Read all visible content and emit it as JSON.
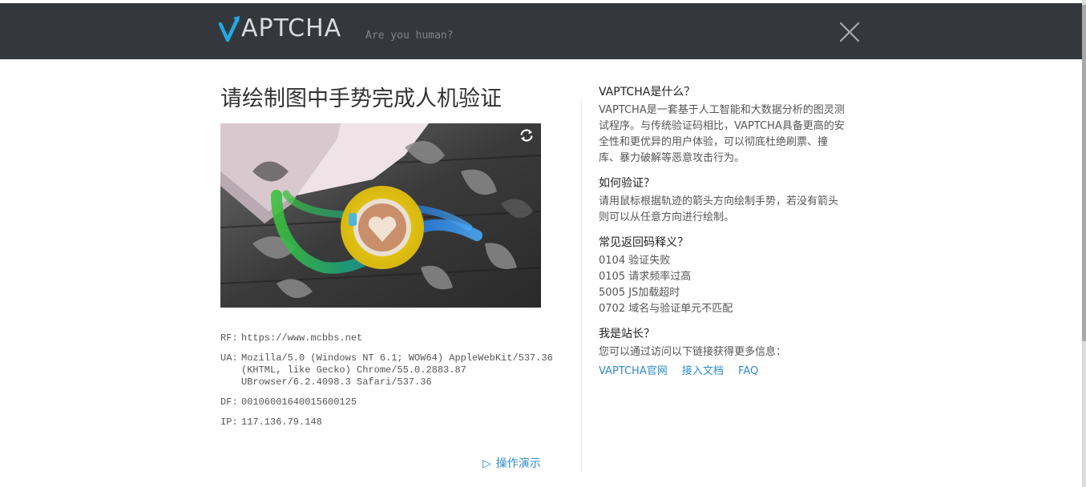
{
  "header": {
    "logo_text": "APTCHA",
    "tagline": "Are you human?",
    "colors": {
      "bar": "#34383c",
      "logo_accent": "#21a9e6",
      "logo_text": "#d7dadd"
    }
  },
  "left": {
    "title": "请绘制图中手势完成人机验证",
    "info": {
      "rf_label": "RF:",
      "rf_value": "https://www.mcbbs.net",
      "ua_label": "UA:",
      "ua_line1": "Mozilla/5.0 (Windows NT 6.1; WOW64) AppleWebKit/537.36",
      "ua_line2": "(KHTML, like Gecko) Chrome/55.0.2883.87",
      "ua_line3": "UBrowser/6.2.4098.3 Safari/537.36",
      "df_label": "DF:",
      "df_value": "00106001640015600125",
      "ip_label": "IP:",
      "ip_value": "117.136.79.148"
    },
    "demo_label": "操作演示"
  },
  "right": {
    "s1_title": "VAPTCHA是什么？",
    "s1_lines": [
      "VAPTCHA是一套基于人工智能和大数据分析的图灵测",
      "试程序。与传统验证码相比，VAPTCHA具备更高的安",
      "全性和更优异的用户体验，可以彻底杜绝刷票、撞",
      "库、暴力破解等恶意攻击行为。"
    ],
    "s2_title": "如何验证？",
    "s2_lines": [
      "请用鼠标根据轨迹的箭头方向绘制手势，若没有箭头",
      "则可以从任意方向进行绘制。"
    ],
    "s3_title": "常见返回码释义？",
    "codes": [
      "0104 验证失败",
      "0105 请求频率过高",
      "5005 JS加载超时",
      "0702 域名与验证单元不匹配"
    ],
    "s4_title": "我是站长？",
    "s4_text": "您可以通过访问以下链接获得更多信息：",
    "links": [
      "VAPTCHA官网",
      "接入文档",
      "FAQ"
    ]
  },
  "icons": [
    "vaptcha-logo-icon",
    "close-icon",
    "refresh-icon",
    "play-triangle-icon"
  ]
}
